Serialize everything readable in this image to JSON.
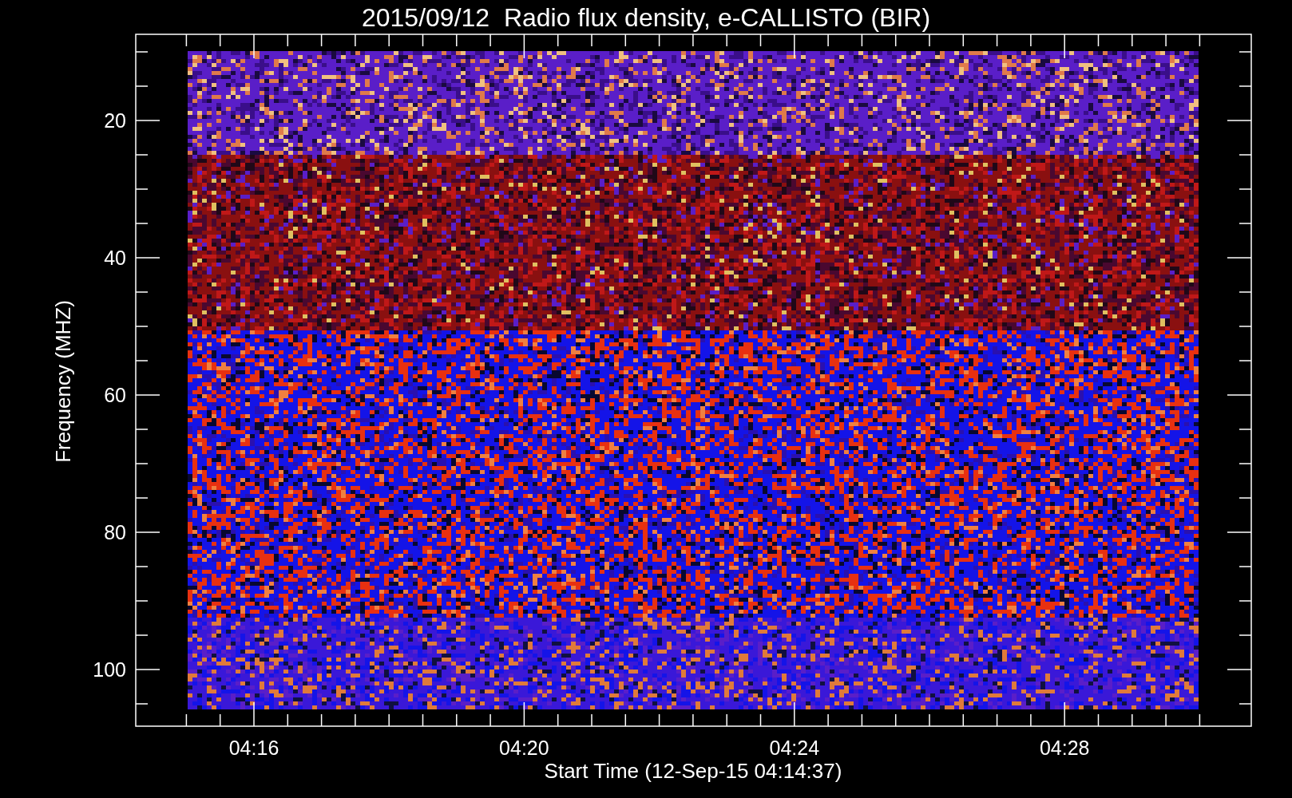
{
  "title": "2015/09/12  Radio flux density, e-CALLISTO (BIR)",
  "y_axis": {
    "label": "Frequency (MHZ)",
    "ticks": [
      "20",
      "40",
      "60",
      "80",
      "100"
    ]
  },
  "x_axis": {
    "label": "Start Time (12-Sep-15 04:14:37)",
    "ticks": [
      "04:16",
      "04:20",
      "04:24",
      "04:28"
    ]
  }
}
